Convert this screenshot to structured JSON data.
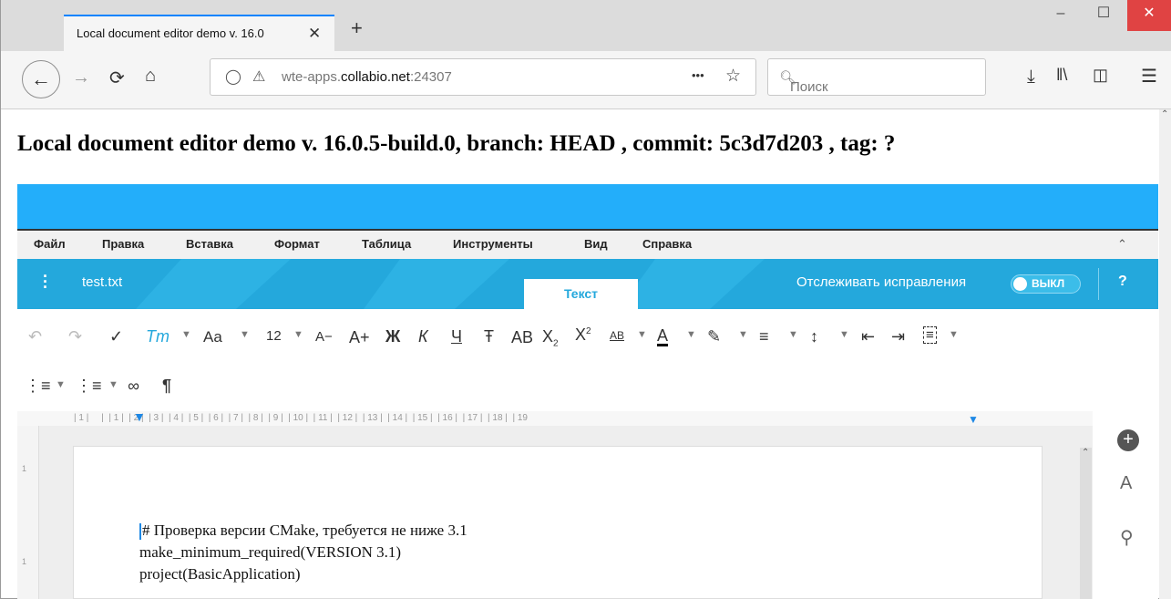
{
  "browser": {
    "tab_title": "Local document editor demo v. 16.0",
    "tab_close": "✕",
    "new_tab": "+",
    "url_host_prefix": "wte-apps.",
    "url_host_main": "collabio.net",
    "url_port": ":24307",
    "more_actions": "•••",
    "search_placeholder": "Поиск",
    "window_controls": {
      "minimize": "–",
      "maximize": "☐",
      "close": "✕"
    }
  },
  "page": {
    "title": "Local document editor demo v. 16.0.5-build.0, branch: HEAD , commit: 5c3d7d203 , tag: ?"
  },
  "editor": {
    "menu": [
      "Файл",
      "Правка",
      "Вставка",
      "Формат",
      "Таблица",
      "Инструменты",
      "Вид",
      "Справка"
    ],
    "filename": "test.txt",
    "active_tab": "Текст",
    "track_changes_label": "Отслеживать исправления",
    "track_changes_state": "ВЫКЛ",
    "help": "?",
    "font_size": "12",
    "toolbar_labels": {
      "font_case": "Aa",
      "font_decrease": "A−",
      "font_increase": "A+",
      "bold": "Ж",
      "italic": "К",
      "underline": "Ч",
      "strikethrough": "Ŧ",
      "allcaps": "AB"
    },
    "ruler_marks": [
      "1",
      "2",
      "3",
      "4",
      "5",
      "6",
      "7",
      "8",
      "9",
      "10",
      "11",
      "12",
      "13",
      "14",
      "15",
      "16",
      "17",
      "18",
      "19"
    ],
    "document_lines": [
      "# Проверка версии CMake, требуется не ниже 3.1",
      "make_minimum_required(VERSION 3.1)",
      "project(BasicApplication)"
    ]
  },
  "colors": {
    "accent_blue": "#23aefa",
    "header_blue": "#24a8dc"
  }
}
